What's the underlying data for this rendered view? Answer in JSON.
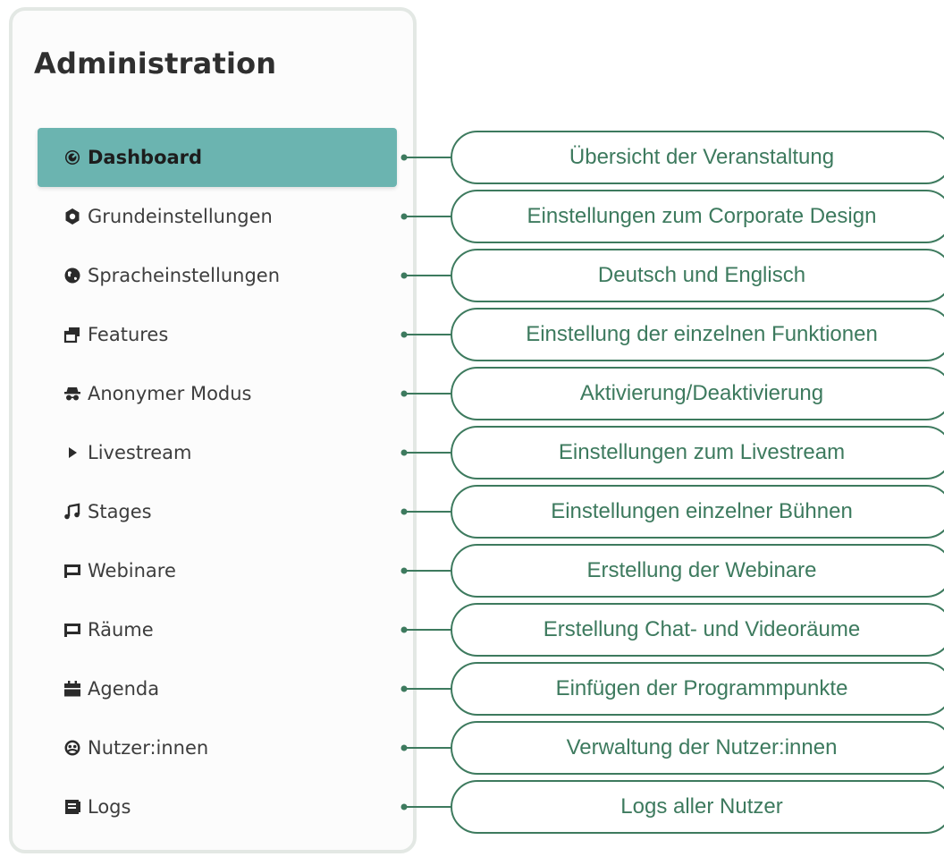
{
  "panel": {
    "title": "Administration"
  },
  "menu": [
    {
      "label": "Dashboard",
      "icon": "dashboard-gauge-icon",
      "active": true
    },
    {
      "label": "Grundeinstellungen",
      "icon": "gear-icon",
      "active": false
    },
    {
      "label": "Spracheinstellungen",
      "icon": "globe-icon",
      "active": false
    },
    {
      "label": "Features",
      "icon": "windows-icon",
      "active": false
    },
    {
      "label": "Anonymer Modus",
      "icon": "incognito-icon",
      "active": false
    },
    {
      "label": "Livestream",
      "icon": "play-icon",
      "active": false
    },
    {
      "label": "Stages",
      "icon": "music-note-icon",
      "active": false
    },
    {
      "label": "Webinare",
      "icon": "presentation-screen-icon",
      "active": false
    },
    {
      "label": "Räume",
      "icon": "presentation-screen-icon",
      "active": false
    },
    {
      "label": "Agenda",
      "icon": "calendar-icon",
      "active": false
    },
    {
      "label": "Nutzer:innen",
      "icon": "users-circle-icon",
      "active": false
    },
    {
      "label": "Logs",
      "icon": "log-book-icon",
      "active": false
    }
  ],
  "callouts": [
    "Übersicht der Veranstaltung",
    "Einstellungen zum Corporate Design",
    "Deutsch und Englisch",
    "Einstellung der einzelnen Funktionen",
    "Aktivierung/Deaktivierung",
    "Einstellungen zum Livestream",
    "Einstellungen einzelner Bühnen",
    "Erstellung der Webinare",
    "Erstellung Chat- und Videoräume",
    "Einfügen der Programmpunkte",
    "Verwaltung der Nutzer:innen",
    "Logs aller Nutzer"
  ],
  "colors": {
    "active_bg": "#6bb4b0",
    "callout_border": "#3d7a5e",
    "callout_text": "#3d7a5e",
    "panel_border": "#e3e8e4"
  }
}
